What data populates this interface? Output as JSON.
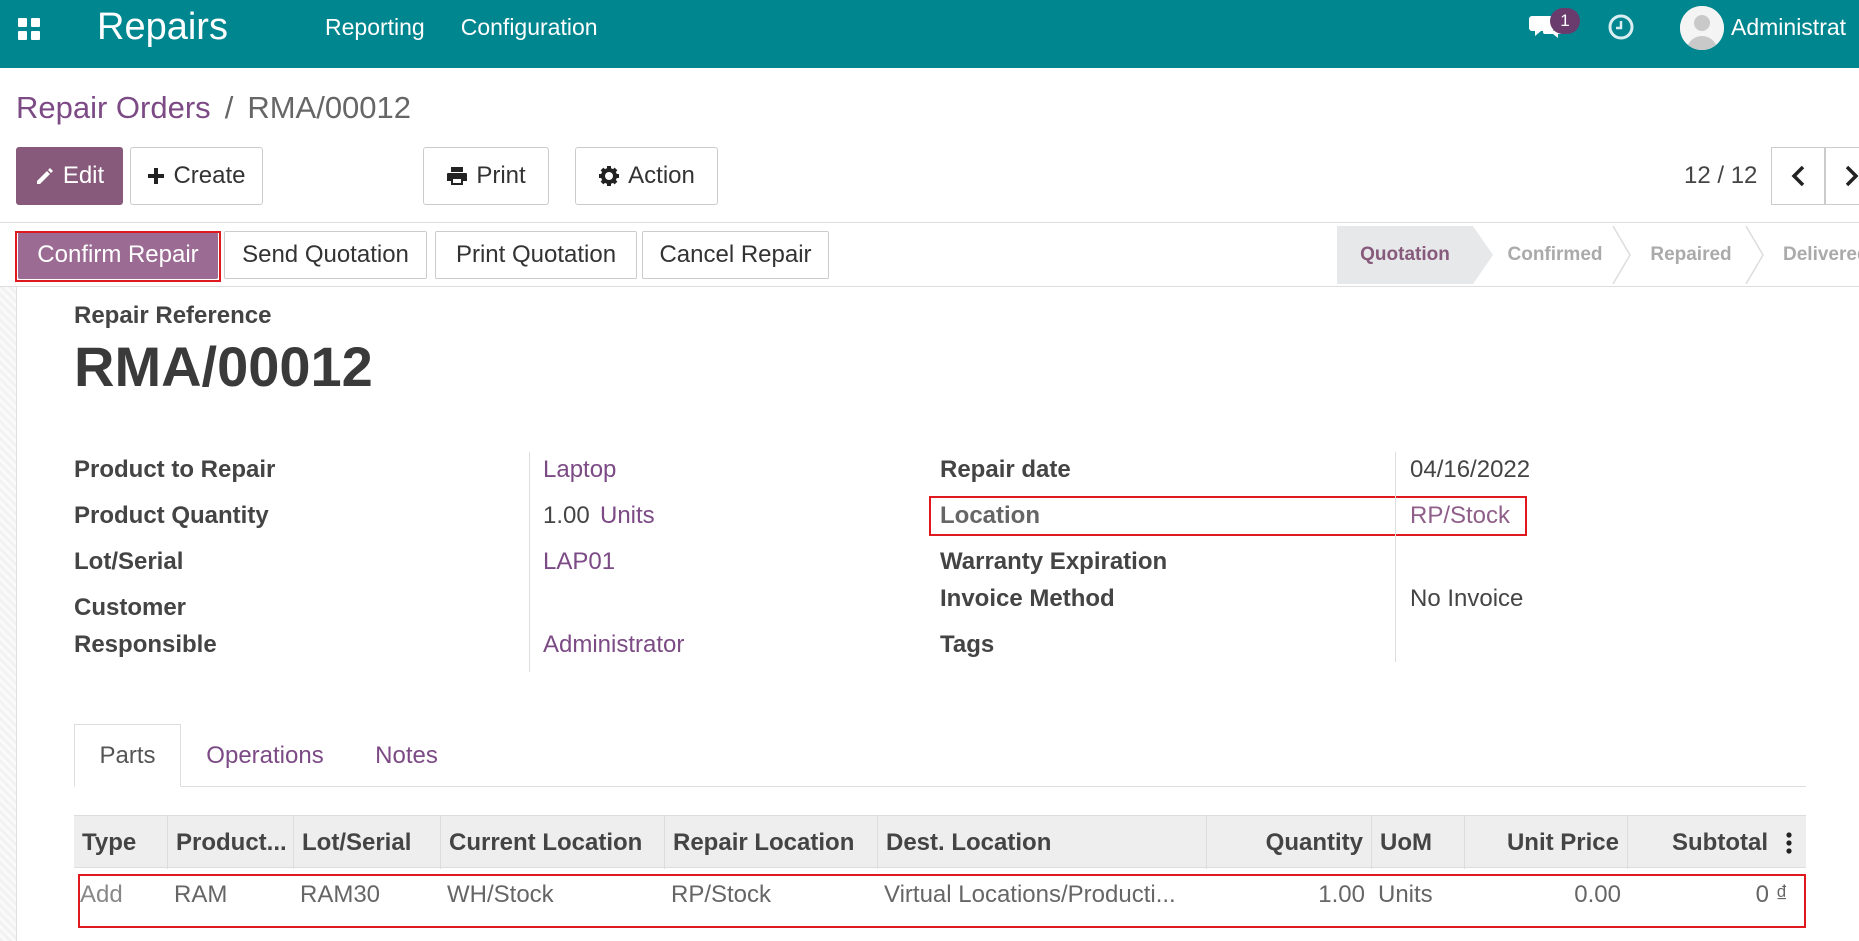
{
  "navbar": {
    "app_title": "Repairs",
    "menu": [
      "Reporting",
      "Configuration"
    ],
    "message_count": "1",
    "user_name": "Administrat",
    "color": "#00868f"
  },
  "breadcrumb": {
    "parent": "Repair Orders",
    "separator": "/",
    "current": "RMA/00012"
  },
  "control_panel": {
    "edit_label": "Edit",
    "create_label": "Create",
    "print_label": "Print",
    "action_label": "Action",
    "pager": "12 / 12"
  },
  "status_buttons": {
    "confirm": "Confirm Repair",
    "send_quotation": "Send Quotation",
    "print_quotation": "Print Quotation",
    "cancel": "Cancel Repair"
  },
  "stages": [
    "Quotation",
    "Confirmed",
    "Repaired",
    "Delivered"
  ],
  "active_stage": "Quotation",
  "form": {
    "ref_label": "Repair Reference",
    "ref_value": "RMA/00012",
    "left": {
      "product_label": "Product to Repair",
      "product_value": "Laptop",
      "qty_label": "Product Quantity",
      "qty_value": "1.00",
      "qty_uom": "Units",
      "lot_label": "Lot/Serial",
      "lot_value": "LAP01",
      "customer_label": "Customer",
      "responsible_label": "Responsible",
      "responsible_value": "Administrator"
    },
    "right": {
      "date_label": "Repair date",
      "date_value": "04/16/2022",
      "location_label": "Location",
      "location_value": "RP/Stock",
      "warranty_label": "Warranty Expiration",
      "invoice_label": "Invoice Method",
      "invoice_value": "No Invoice",
      "tags_label": "Tags"
    }
  },
  "tabs": [
    "Parts",
    "Operations",
    "Notes"
  ],
  "table": {
    "columns": [
      "Type",
      "Product...",
      "Lot/Serial",
      "Current Location",
      "Repair Location",
      "Dest. Location",
      "Quantity",
      "UoM",
      "Unit Price",
      "Subtotal"
    ],
    "rows": [
      [
        "Add",
        "RAM",
        "RAM30",
        "WH/Stock",
        "RP/Stock",
        "Virtual Locations/Producti...",
        "1.00",
        "Units",
        "0.00",
        "0 ₫"
      ]
    ]
  },
  "colors": {
    "brand": "#00868f",
    "primary": "#875a7b",
    "link": "#7c4a85",
    "highlight": "#e0191e"
  }
}
